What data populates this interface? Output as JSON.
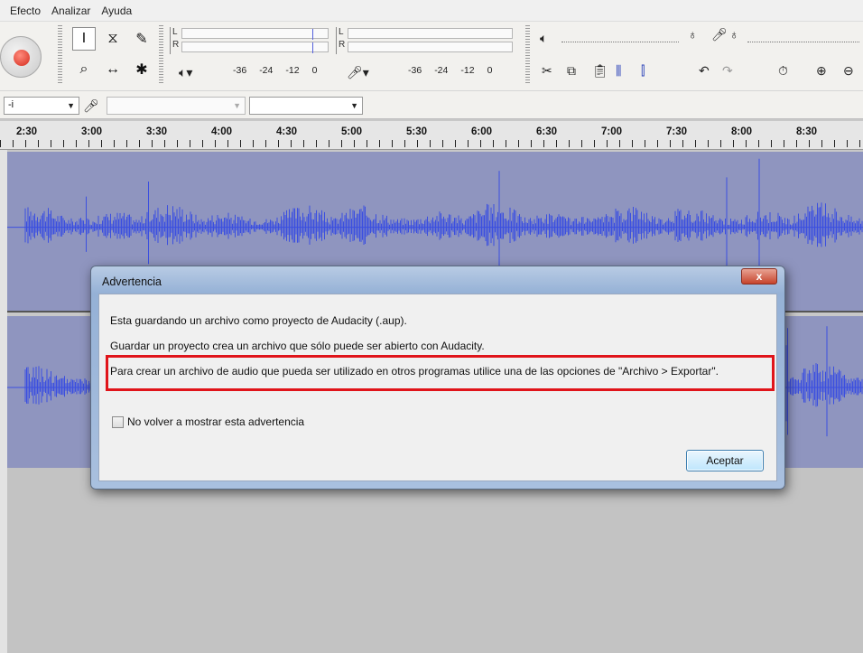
{
  "menu": [
    "Efecto",
    "Analizar",
    "Ayuda"
  ],
  "meters": {
    "left_label": "L",
    "right_label": "R",
    "scale": [
      "-36",
      "-24",
      "-12",
      "0"
    ]
  },
  "device": {
    "host_value": "-i"
  },
  "timeline": [
    "2:30",
    "3:00",
    "3:30",
    "4:00",
    "4:30",
    "5:00",
    "5:30",
    "6:00",
    "6:30",
    "7:00",
    "7:30",
    "8:00",
    "8:30"
  ],
  "dialog": {
    "title": "Advertencia",
    "close_label": "x",
    "line1": "Esta guardando un archivo como proyecto de Audacity (.aup).",
    "line2": "Guardar un proyecto crea un archivo que sólo puede ser abierto con Audacity.",
    "line3": "Para crear un archivo de audio que pueda ser utilizado en otros programas utilice una de las opciones de \"Archivo > Exportar\".",
    "checkbox_label": "No volver a mostrar esta advertencia",
    "ok_label": "Aceptar"
  },
  "colors": {
    "waveform": "#3b4fe0",
    "track_bg": "#8f95bf",
    "highlight": "#e0141a"
  }
}
